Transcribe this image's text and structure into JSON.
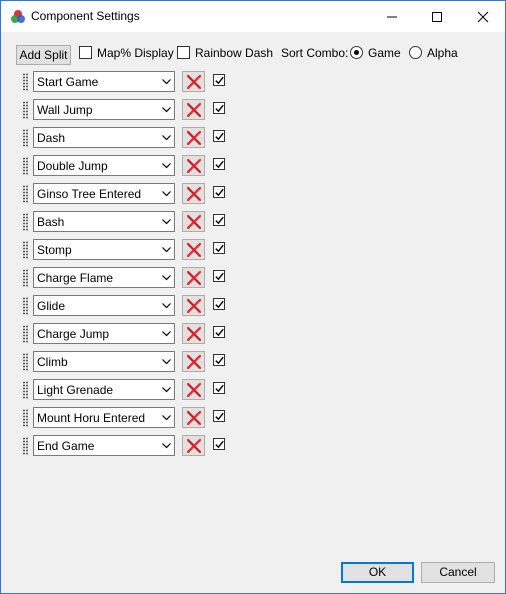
{
  "window": {
    "title": "Component Settings"
  },
  "toolbar": {
    "add_split_label": "Add Split",
    "map_display_label": "Map% Display",
    "map_display_checked": false,
    "rainbow_dash_label": "Rainbow Dash",
    "rainbow_dash_checked": false,
    "sort_combo_label": "Sort Combo:",
    "sort_options": [
      {
        "label": "Game",
        "selected": true
      },
      {
        "label": "Alpha",
        "selected": false
      }
    ]
  },
  "splits": [
    {
      "value": "Start Game",
      "checked": true
    },
    {
      "value": "Wall Jump",
      "checked": true
    },
    {
      "value": "Dash",
      "checked": true
    },
    {
      "value": "Double Jump",
      "checked": true
    },
    {
      "value": "Ginso Tree Entered",
      "checked": true
    },
    {
      "value": "Bash",
      "checked": true
    },
    {
      "value": "Stomp",
      "checked": true
    },
    {
      "value": "Charge Flame",
      "checked": true
    },
    {
      "value": "Glide",
      "checked": true
    },
    {
      "value": "Charge Jump",
      "checked": true
    },
    {
      "value": "Climb",
      "checked": true
    },
    {
      "value": "Light Grenade",
      "checked": true
    },
    {
      "value": "Mount Horu Entered",
      "checked": true
    },
    {
      "value": "End Game",
      "checked": true
    }
  ],
  "footer": {
    "ok_label": "OK",
    "cancel_label": "Cancel"
  },
  "colors": {
    "accent": "#0078d7",
    "delete_x": "#e0313b",
    "window_border": "#2b79d6"
  },
  "icons": {
    "app": "rgb-circles-icon",
    "minimize": "minimize-icon",
    "maximize": "maximize-icon",
    "close": "close-icon",
    "delete": "delete-x-icon",
    "dropdown": "chevron-down-icon",
    "check": "checkmark-icon",
    "grip": "drag-handle-icon"
  }
}
